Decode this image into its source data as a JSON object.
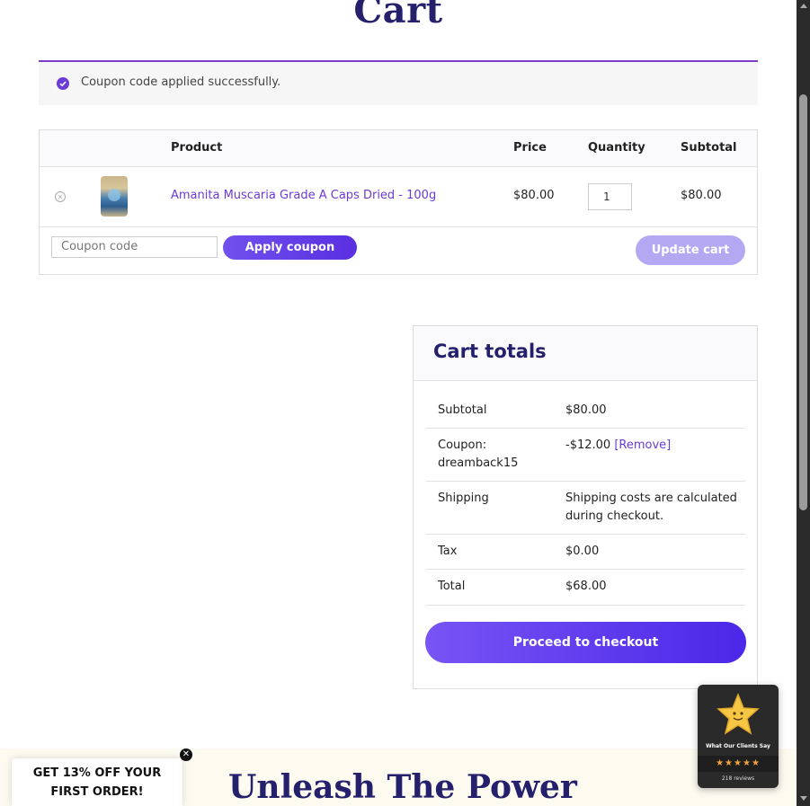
{
  "page": {
    "title": "Cart"
  },
  "notice": {
    "message": "Coupon code applied successfully.",
    "icon": "check-circle-icon"
  },
  "cart_table": {
    "headers": {
      "product": "Product",
      "price": "Price",
      "quantity": "Quantity",
      "subtotal": "Subtotal"
    },
    "items": [
      {
        "name": "Amanita Muscaria Grade A Caps Dried - 100g",
        "price": "$80.00",
        "quantity": "1",
        "subtotal": "$80.00"
      }
    ],
    "coupon_placeholder": "Coupon code",
    "apply_label": "Apply coupon",
    "update_label": "Update cart"
  },
  "totals": {
    "title": "Cart totals",
    "subtotal": {
      "label": "Subtotal",
      "value": "$80.00"
    },
    "coupon": {
      "label": "Coupon: dreamback15",
      "value": "-$12.00",
      "remove": "[Remove]"
    },
    "shipping": {
      "label": "Shipping",
      "value": "Shipping costs are calculated during checkout."
    },
    "tax": {
      "label": "Tax",
      "value": "$0.00"
    },
    "total": {
      "label": "Total",
      "value": "$68.00"
    },
    "checkout_label": "Proceed to checkout"
  },
  "banner": {
    "title": "Unleash The Power"
  },
  "promo": {
    "text": "GET 13% OFF YOUR\nFIRST ORDER!",
    "close": "✕"
  },
  "reviews": {
    "caption": "What Our Clients Say",
    "stars": "★★★★★",
    "count": "218 reviews",
    "rating": 5
  },
  "colors": {
    "accent": "#6a3bd6",
    "heading": "#25206b",
    "button": "#5a2fe0"
  }
}
